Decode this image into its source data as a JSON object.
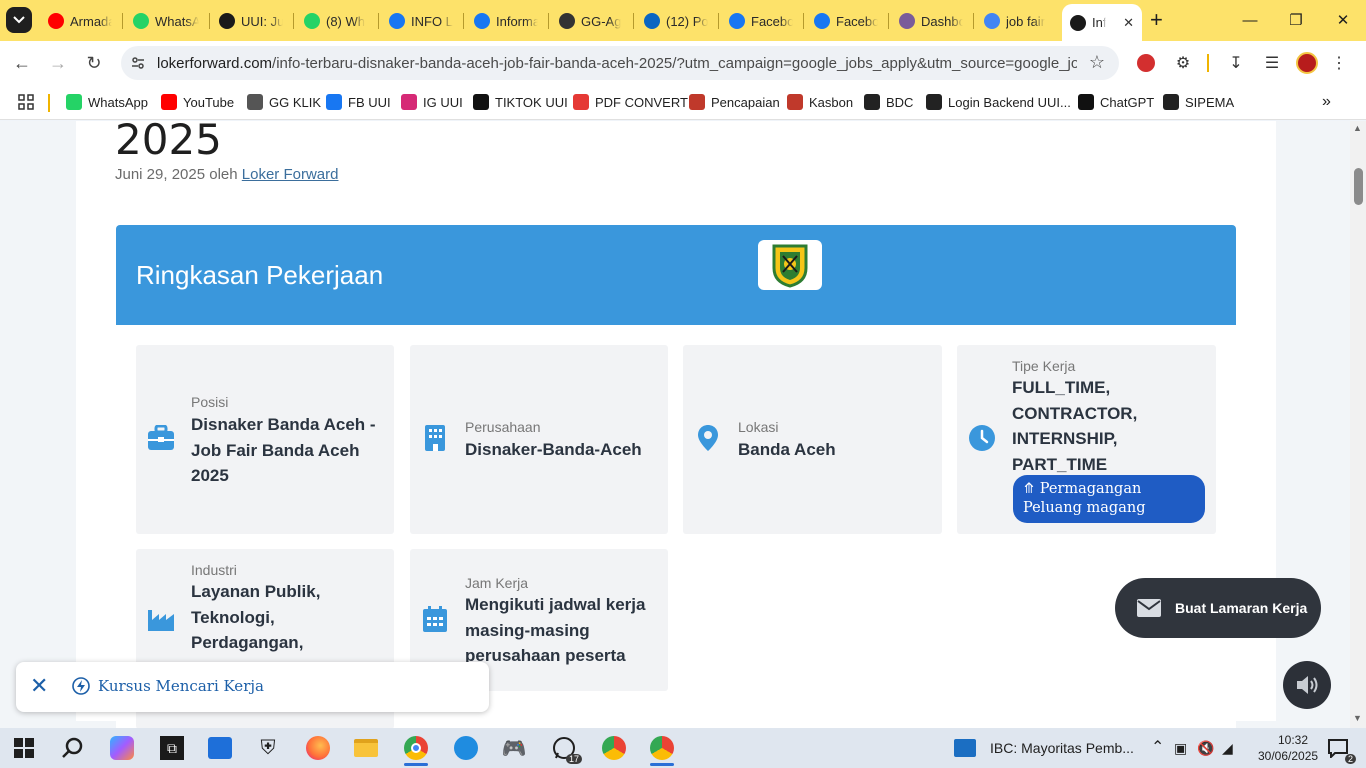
{
  "tabs": [
    {
      "label": "Armada",
      "icon": "youtube-icon",
      "color": "#ff0000"
    },
    {
      "label": "WhatsApp",
      "icon": "whatsapp-icon",
      "color": "#25d366"
    },
    {
      "label": "UUI: Ju",
      "icon": "uui-icon",
      "color": "#1a1a1a"
    },
    {
      "label": "(8) Wh",
      "icon": "whatsapp-icon",
      "color": "#25d366"
    },
    {
      "label": "INFO L",
      "icon": "facebook-icon",
      "color": "#1877f2"
    },
    {
      "label": "Informa",
      "icon": "facebook-icon",
      "color": "#1877f2"
    },
    {
      "label": "GG-Ag",
      "icon": "gg-icon",
      "color": "#333333"
    },
    {
      "label": "(12) Po",
      "icon": "linkedin-icon",
      "color": "#0a66c2"
    },
    {
      "label": "Facebo",
      "icon": "facebook-icon",
      "color": "#1877f2"
    },
    {
      "label": "Facebo",
      "icon": "facebook-icon",
      "color": "#1877f2"
    },
    {
      "label": "Dashbo",
      "icon": "dashboard-icon",
      "color": "#7a5c9a"
    },
    {
      "label": "job fair",
      "icon": "google-icon",
      "color": "#4285f4"
    },
    {
      "label": "Inf",
      "icon": "site-icon",
      "color": "#1a1a1a"
    }
  ],
  "url": {
    "host": "lokerforward.com",
    "path": "/info-terbaru-disnaker-banda-aceh-job-fair-banda-aceh-2025/?utm_campaign=google_jobs_apply&utm_source=google_jobs_ap..."
  },
  "bookmarks": [
    {
      "label": "WhatsApp",
      "icon": "whatsapp-icon",
      "color": "#25d366"
    },
    {
      "label": "YouTube",
      "icon": "youtube-icon",
      "color": "#ff0000"
    },
    {
      "label": "GG KLIK",
      "icon": "gg-icon",
      "color": "#555555"
    },
    {
      "label": "FB UUI",
      "icon": "facebook-icon",
      "color": "#1877f2"
    },
    {
      "label": "IG UUI",
      "icon": "instagram-icon",
      "color": "#d62976"
    },
    {
      "label": "TIKTOK UUI",
      "icon": "tiktok-icon",
      "color": "#111111"
    },
    {
      "label": "PDF CONVERT",
      "icon": "heart-icon",
      "color": "#e53935"
    },
    {
      "label": "Pencapaian",
      "icon": "feather-icon",
      "color": "#c0392b"
    },
    {
      "label": "Kasbon",
      "icon": "feather-icon",
      "color": "#c0392b"
    },
    {
      "label": "BDC",
      "icon": "globe-icon",
      "color": "#222222"
    },
    {
      "label": "Login Backend UUI...",
      "icon": "uui-icon",
      "color": "#222222"
    },
    {
      "label": "ChatGPT",
      "icon": "chatgpt-icon",
      "color": "#111111"
    },
    {
      "label": "SIPEMA",
      "icon": "globe-icon",
      "color": "#222222"
    }
  ],
  "article": {
    "title_fragment": "2025",
    "date": "Juni 29, 2025",
    "by": "oleh",
    "author": "Loker Forward"
  },
  "summary": {
    "title": "Ringkasan Pekerjaan",
    "header_color": "#3a97dc",
    "tiles": [
      {
        "label": "Posisi",
        "value": "Disnaker Banda Aceh - Job Fair Banda Aceh 2025",
        "icon": "briefcase-icon"
      },
      {
        "label": "Perusahaan",
        "value": "Disnaker-Banda-Aceh",
        "icon": "building-icon"
      },
      {
        "label": "Lokasi",
        "value": "Banda Aceh",
        "icon": "map-pin-icon"
      },
      {
        "label": "Tipe Kerja",
        "value": "FULL_TIME, CONTRACTOR, INTERNSHIP, PART_TIME",
        "icon": "clock-icon"
      },
      {
        "label": "Industri",
        "value": "Layanan Publik, Teknologi, Perdagangan,",
        "icon": "industry-icon"
      },
      {
        "label": "Jam Kerja",
        "value": "Mengikuti jadwal kerja masing-masing perusahaan peserta",
        "icon": "calendar-icon"
      }
    ],
    "internship_button": "Permagangan Peluang magang"
  },
  "apply_button": "Buat Lamaran Kerja",
  "bottom_link": "Kursus Mencari Kerja",
  "taskbar": {
    "notification": "IBC: Mayoritas Pemb...",
    "time": "10:32",
    "date": "30/06/2025",
    "whatsapp_badge": "17",
    "notification_count": "2"
  }
}
